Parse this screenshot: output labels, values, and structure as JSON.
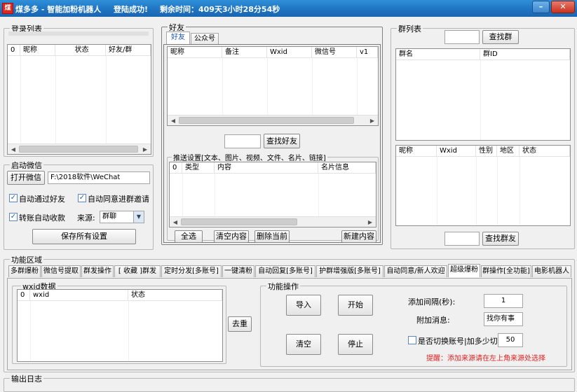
{
  "title_bar": {
    "app_name": "煤多多 - 智能加粉机器人",
    "status": "登陆成功!",
    "remaining": "剩余时间：409天3小时28分54秒",
    "icon_char": "煤"
  },
  "login_list": {
    "title": "登录列表",
    "columns": [
      "0",
      "昵称",
      "状态",
      "好友/群"
    ]
  },
  "launch": {
    "title": "启动微信",
    "open_button": "打开微信",
    "path_value": "F:\\2018软件\\WeChat",
    "auto_pass_friend": "自动通过好友",
    "auto_accept_group": "自动同意进群邀请",
    "auto_receive_transfer": "转账自动收款",
    "source_label": "来源:",
    "source_value": "群聊",
    "save_button": "保存所有设置"
  },
  "friends": {
    "title": "好友",
    "tabs": [
      "好友",
      "公众号"
    ],
    "columns": [
      "昵称",
      "备注",
      "Wxid",
      "微信号",
      "v1"
    ],
    "search_value": "",
    "search_button": "查找好友"
  },
  "push": {
    "title": "推送设置[文本、图片、视频、文件、名片、链接]",
    "columns": [
      "0",
      "类型",
      "内容",
      "名片信息"
    ],
    "buttons": [
      "全选",
      "清空内容",
      "删除当前",
      "新建内容"
    ]
  },
  "groups": {
    "title": "群列表",
    "search_value": "",
    "search_button": "查找群",
    "columns": [
      "群名",
      "群ID"
    ],
    "member_columns": [
      "昵称",
      "Wxid",
      "性别",
      "地区",
      "状态"
    ],
    "member_search_value": "",
    "member_search_button": "查找群友"
  },
  "functions": {
    "title": "功能区域",
    "tabs": [
      "多群爆粉",
      "微信号提取",
      "群发操作",
      "[ 收藏 ]群发",
      "定时分发[多账号]",
      "一键清粉",
      "自动回复[多账号]",
      "护群增强版[多账号]",
      "自动同意/新人欢迎",
      "超级爆粉",
      "群操作[全功能]",
      "电影机器人"
    ],
    "active_tab_index": 9,
    "wxid_title": "wxid数据",
    "wxid_columns": [
      "0",
      "wxid",
      "状态"
    ],
    "dedupe_button": "去重",
    "ops_title": "功能操作",
    "import_button": "导入",
    "start_button": "开始",
    "clear_button": "清空",
    "stop_button": "停止",
    "interval_label": "添加间隔(秒):",
    "interval_value": "1",
    "message_label": "附加消息:",
    "message_value": "找你有事",
    "switch_label": "是否切换账号|加多少切换:",
    "switch_value": "50",
    "hint": "提醒：添加来源请在左上角来源处选择"
  },
  "log": {
    "title": "输出日志"
  }
}
